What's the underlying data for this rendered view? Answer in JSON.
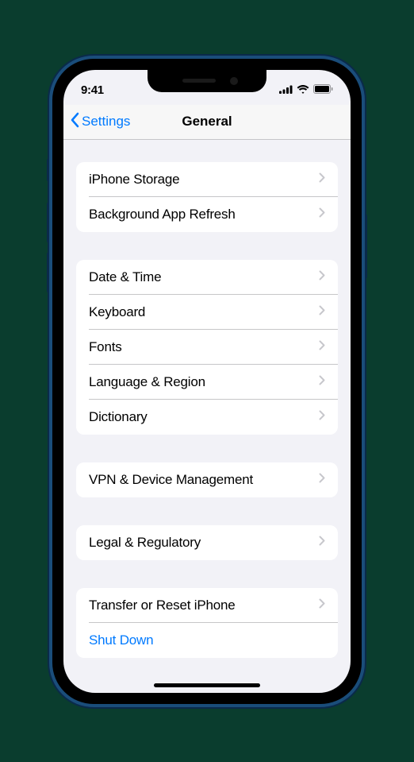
{
  "status": {
    "time": "9:41"
  },
  "nav": {
    "back_label": "Settings",
    "title": "General"
  },
  "groups": [
    {
      "items": [
        {
          "label": "iPhone Storage",
          "chevron": true
        },
        {
          "label": "Background App Refresh",
          "chevron": true
        }
      ]
    },
    {
      "items": [
        {
          "label": "Date & Time",
          "chevron": true
        },
        {
          "label": "Keyboard",
          "chevron": true
        },
        {
          "label": "Fonts",
          "chevron": true
        },
        {
          "label": "Language & Region",
          "chevron": true
        },
        {
          "label": "Dictionary",
          "chevron": true
        }
      ]
    },
    {
      "items": [
        {
          "label": "VPN & Device Management",
          "chevron": true
        }
      ]
    },
    {
      "items": [
        {
          "label": "Legal & Regulatory",
          "chevron": true
        }
      ]
    },
    {
      "items": [
        {
          "label": "Transfer or Reset iPhone",
          "chevron": true
        },
        {
          "label": "Shut Down",
          "chevron": false,
          "blue": true
        }
      ]
    }
  ]
}
